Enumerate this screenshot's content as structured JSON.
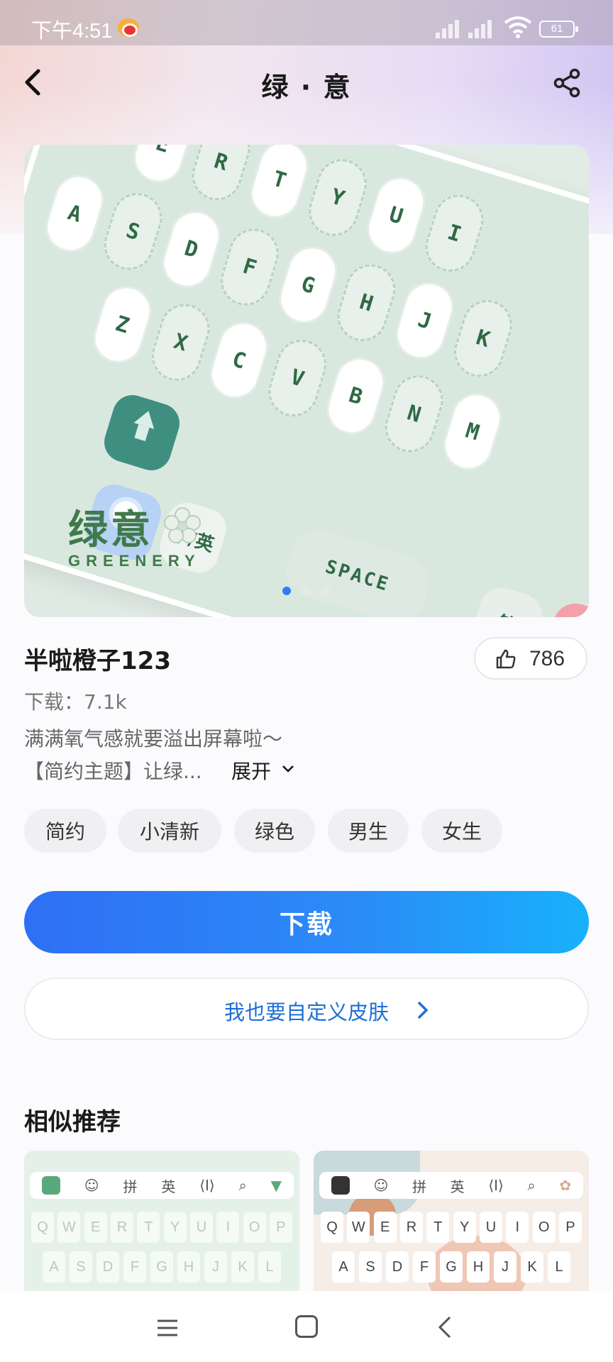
{
  "status_bar": {
    "time": "下午4:51",
    "battery": "61"
  },
  "header": {
    "title": "绿 · 意"
  },
  "banner": {
    "theme_title": "绿意",
    "theme_subtitle": "GREENERY",
    "keys_row1": [
      "E",
      "R",
      "T",
      "Y",
      "U",
      "I"
    ],
    "keys_row2": [
      "A",
      "S",
      "D",
      "F",
      "G",
      "H",
      "J",
      "K"
    ],
    "keys_row3": [
      "Z",
      "X",
      "C",
      "V",
      "B",
      "N",
      "M"
    ],
    "zh_key": "中/英",
    "space_key": "SPACE",
    "fu_key": "符",
    "page_count": 3,
    "active_page": 1
  },
  "info": {
    "author": "半啦橙子123",
    "like_count": "786",
    "downloads": "下载：7.1k",
    "desc_line1": "满满氧气感就要溢出屏幕啦～",
    "desc_line2": "【简约主题】让绿...",
    "expand_label": "展开"
  },
  "tags": [
    "简约",
    "小清新",
    "绿色",
    "男生",
    "女生"
  ],
  "actions": {
    "download_label": "下载",
    "custom_label": "我也要自定义皮肤"
  },
  "similar": {
    "title": "相似推荐",
    "toolbar": [
      "拼",
      "英"
    ],
    "row1": [
      "Q",
      "W",
      "E",
      "R",
      "T",
      "Y",
      "U",
      "I",
      "O",
      "P"
    ],
    "row2": [
      "A",
      "S",
      "D",
      "F",
      "G",
      "H",
      "J",
      "K",
      "L"
    ]
  },
  "colors": {
    "accent": "#2f7df6",
    "theme_green": "#3f7a4a",
    "link_blue": "#1d6fd6"
  }
}
